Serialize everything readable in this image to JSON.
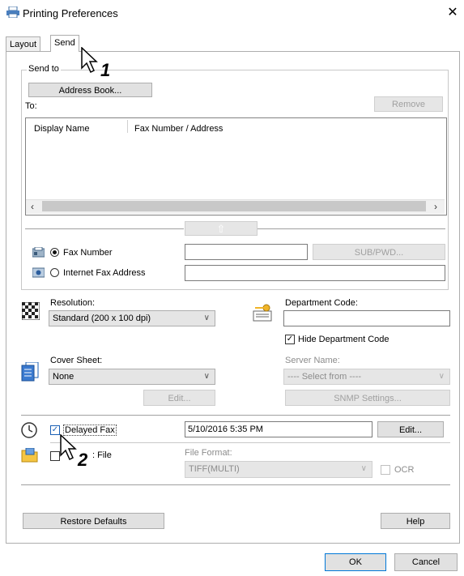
{
  "window": {
    "title": "Printing Preferences"
  },
  "tabs": [
    {
      "label": "Layout"
    },
    {
      "label": "Send"
    }
  ],
  "send_to": {
    "group_label": "Send to",
    "address_book_label": "Address Book...",
    "to_label": "To:",
    "remove_label": "Remove",
    "columns": [
      "Display Name",
      "Fax Number / Address"
    ],
    "up_arrow": "⇧",
    "fax_number_label": "Fax Number",
    "fax_number_value": "",
    "internet_fax_label": "Internet Fax Address",
    "internet_fax_value": "",
    "sub_pwd_label": "SUB/PWD..."
  },
  "resolution": {
    "label": "Resolution:",
    "value": "Standard (200 x 100 dpi)"
  },
  "department": {
    "label": "Department Code:",
    "value": "",
    "hide_label": "Hide Department Code",
    "hide_checked": true
  },
  "cover_sheet": {
    "label": "Cover Sheet:",
    "value": "None",
    "edit_label": "Edit..."
  },
  "server": {
    "label": "Server Name:",
    "value": "---- Select from ----",
    "snmp_label": "SNMP Settings..."
  },
  "delayed_fax": {
    "label": "Delayed Fax",
    "checked": true,
    "datetime": "5/10/2016 5:35 PM",
    "edit_label": "Edit..."
  },
  "archive": {
    "label_visible": ": File",
    "checked": false,
    "format_label": "File Format:",
    "format_value": "TIFF(MULTI)",
    "ocr_label": "OCR"
  },
  "footer": {
    "restore_label": "Restore Defaults",
    "help_label": "Help"
  },
  "dialog": {
    "ok_label": "OK",
    "cancel_label": "Cancel"
  },
  "callouts": [
    "1",
    "2"
  ],
  "colors": {
    "accent": "#1a5fb4",
    "checked_border": "#1a5fb4"
  }
}
